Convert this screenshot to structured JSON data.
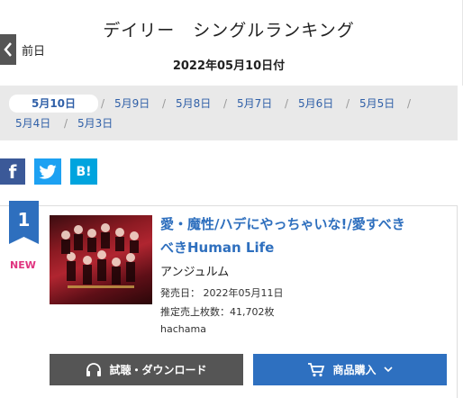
{
  "header": {
    "title": "デイリー　シングルランキング",
    "date": "2022年05月10日付",
    "prev_label": "前日"
  },
  "dates": {
    "active": "5月10日",
    "row1": [
      "5月9日",
      "5月8日",
      "5月7日",
      "5月6日",
      "5月5日"
    ],
    "row2": [
      "5月4日",
      "5月3日"
    ],
    "separator": "/"
  },
  "share": {
    "facebook": "f",
    "hatena": "B!"
  },
  "entry": {
    "rank": "1",
    "badge": "NEW",
    "title": "愛・魔性/ハデにやっちゃいな!/愛すべきべきHuman Life",
    "title_line1": "愛・魔性/ハデにやっちゃいな!/愛すべき",
    "title_line2": "べきHuman Life",
    "artist": "アンジュルム",
    "release": "発売日：  2022年05月11日",
    "sales": "推定売上枚数：41,702枚",
    "label": "hachama"
  },
  "buttons": {
    "listen": "試聴・ダウンロード",
    "buy": "商品購入"
  },
  "colors": {
    "link": "#2e6fbe",
    "rank_badge": "#2e6fbe",
    "new": "#e0337f",
    "listen_btn": "#555555",
    "buy_btn": "#2e70c0"
  },
  "icons": {
    "prev": "chevron-left-icon",
    "listen": "headphones-icon",
    "buy": "cart-icon",
    "dropdown": "chevron-down-icon"
  }
}
